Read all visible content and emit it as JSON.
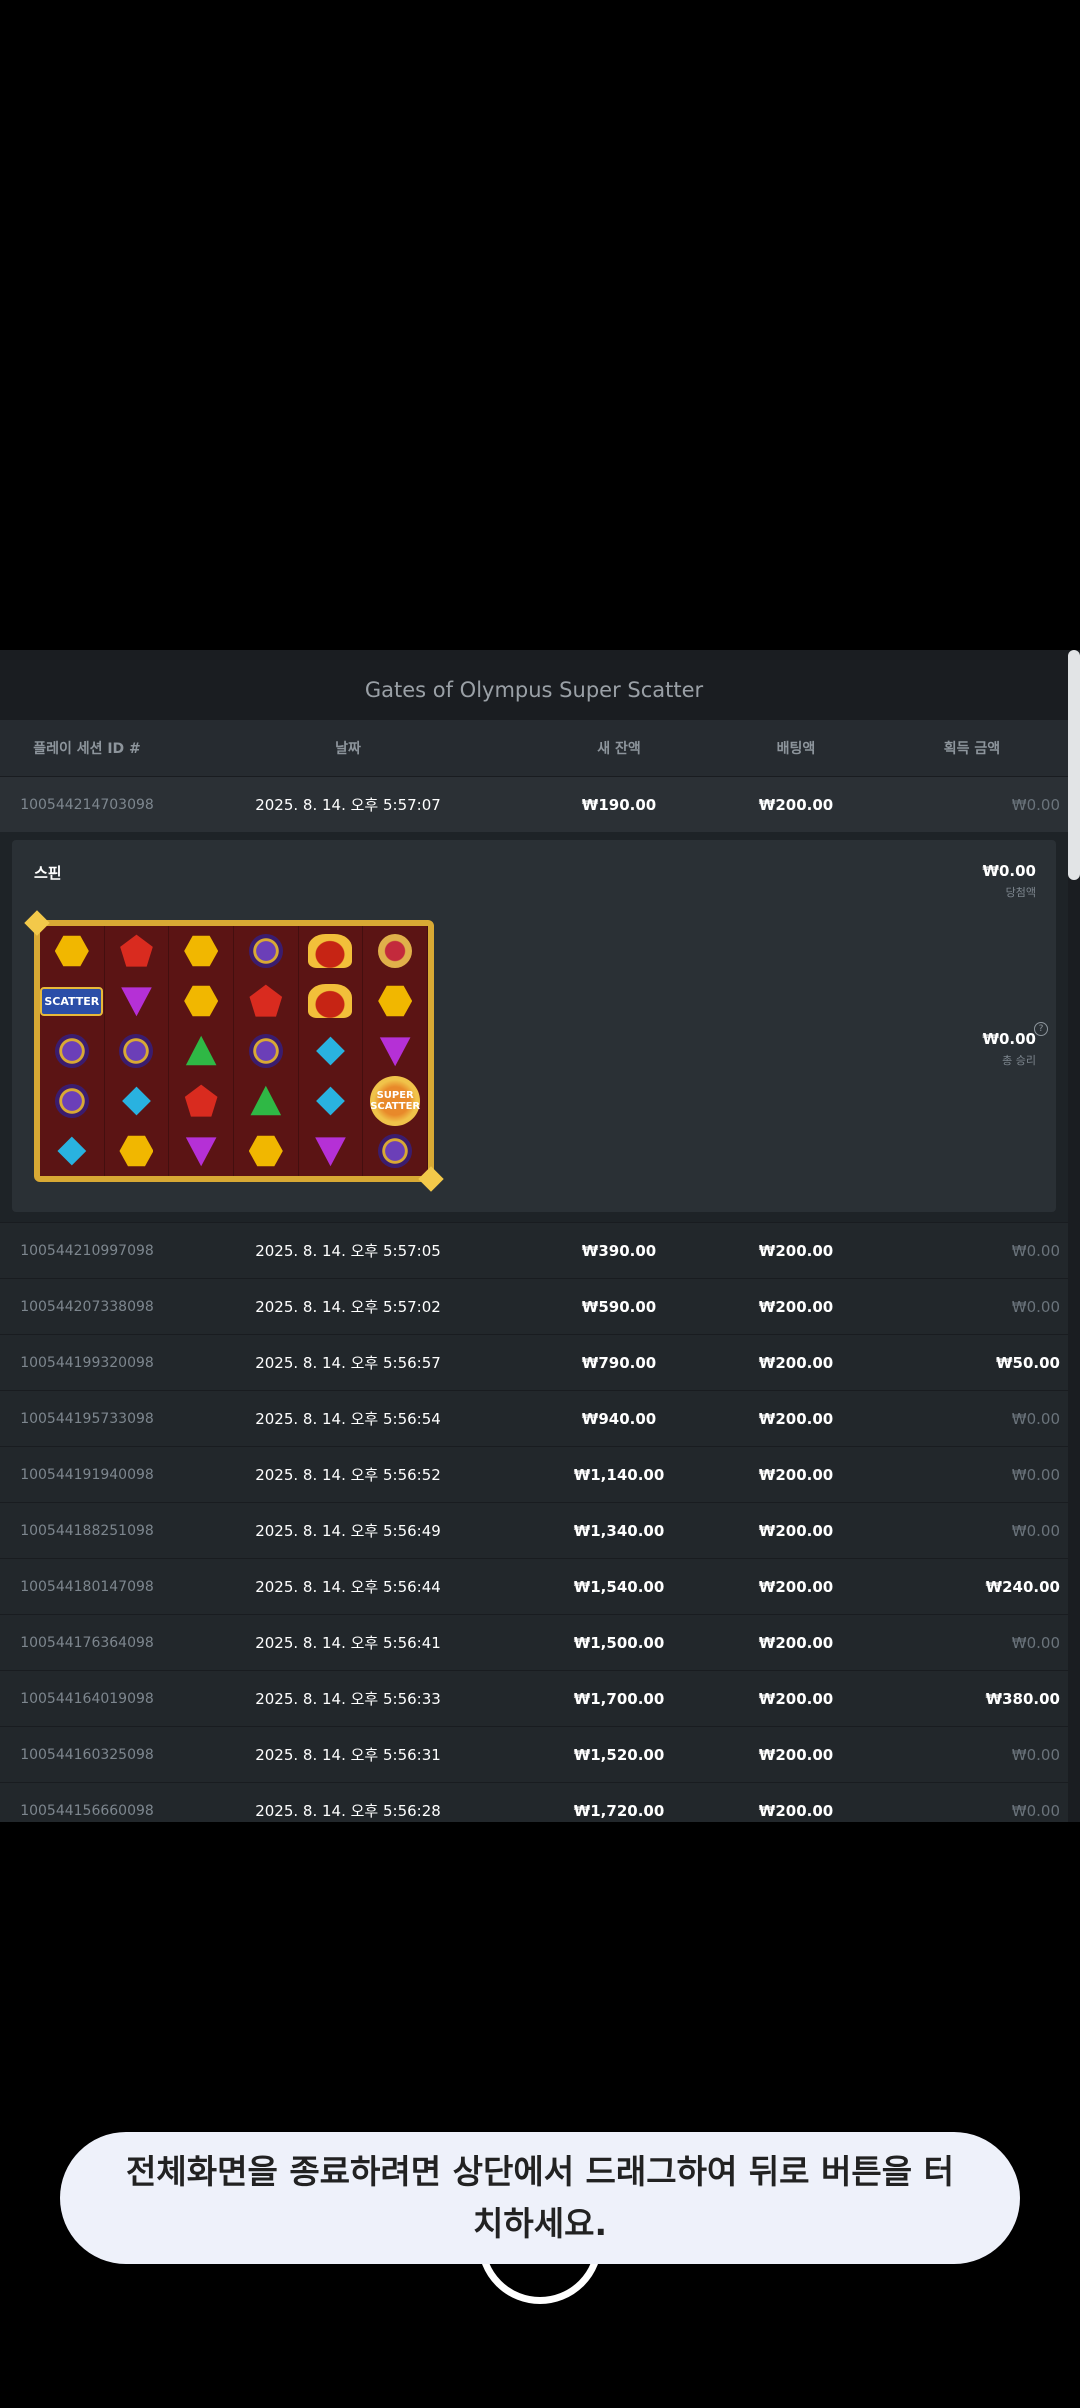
{
  "panel": {
    "title": "Gates of Olympus Super Scatter",
    "columns": {
      "session_id": "플레이 세션 ID #",
      "date": "날짜",
      "new_balance": "새 잔액",
      "bet": "배팅액",
      "win": "획득 금액"
    }
  },
  "selected_row": {
    "id": "100544214703098",
    "date": "2025. 8. 14. 오후 5:57:07",
    "balance": "₩190.00",
    "bet": "₩200.00",
    "win": "₩0.00"
  },
  "detail": {
    "spin_label": "스핀",
    "win_amount": "₩0.00",
    "win_label": "당첨액",
    "total_amount": "₩0.00",
    "total_label": "총 승리",
    "help_glyph": "?",
    "scatter_label": "SCATTER",
    "super_scatter_label": "SUPER SCATTER"
  },
  "rows": [
    {
      "id": "100544210997098",
      "date": "2025. 8. 14. 오후 5:57:05",
      "balance": "₩390.00",
      "bet": "₩200.00",
      "win": "₩0.00"
    },
    {
      "id": "100544207338098",
      "date": "2025. 8. 14. 오후 5:57:02",
      "balance": "₩590.00",
      "bet": "₩200.00",
      "win": "₩0.00"
    },
    {
      "id": "100544199320098",
      "date": "2025. 8. 14. 오후 5:56:57",
      "balance": "₩790.00",
      "bet": "₩200.00",
      "win": "₩50.00"
    },
    {
      "id": "100544195733098",
      "date": "2025. 8. 14. 오후 5:56:54",
      "balance": "₩940.00",
      "bet": "₩200.00",
      "win": "₩0.00"
    },
    {
      "id": "100544191940098",
      "date": "2025. 8. 14. 오후 5:56:52",
      "balance": "₩1,140.00",
      "bet": "₩200.00",
      "win": "₩0.00"
    },
    {
      "id": "100544188251098",
      "date": "2025. 8. 14. 오후 5:56:49",
      "balance": "₩1,340.00",
      "bet": "₩200.00",
      "win": "₩0.00"
    },
    {
      "id": "100544180147098",
      "date": "2025. 8. 14. 오후 5:56:44",
      "balance": "₩1,540.00",
      "bet": "₩200.00",
      "win": "₩240.00"
    },
    {
      "id": "100544176364098",
      "date": "2025. 8. 14. 오후 5:56:41",
      "balance": "₩1,500.00",
      "bet": "₩200.00",
      "win": "₩0.00"
    },
    {
      "id": "100544164019098",
      "date": "2025. 8. 14. 오후 5:56:33",
      "balance": "₩1,700.00",
      "bet": "₩200.00",
      "win": "₩380.00"
    },
    {
      "id": "100544160325098",
      "date": "2025. 8. 14. 오후 5:56:31",
      "balance": "₩1,520.00",
      "bet": "₩200.00",
      "win": "₩0.00"
    },
    {
      "id": "100544156660098",
      "date": "2025. 8. 14. 오후 5:56:28",
      "balance": "₩1,720.00",
      "bet": "₩200.00",
      "win": "₩0.00"
    }
  ],
  "board": {
    "columns": [
      [
        "hex",
        "scatter",
        "ring",
        "ring",
        "dia"
      ],
      [
        "pent",
        "tri-v",
        "ring",
        "dia",
        "hex"
      ],
      [
        "hex",
        "hex",
        "tri",
        "pent",
        "tri-v"
      ],
      [
        "ring",
        "pent",
        "ring",
        "tri",
        "hex"
      ],
      [
        "crown",
        "crown",
        "dia",
        "dia",
        "tri-v"
      ],
      [
        "cup",
        "hex",
        "tri-v",
        "super",
        "ring"
      ]
    ]
  },
  "toast": {
    "message": "전체화면을 종료하려면 상단에서 드래그하여 뒤로 버튼을 터치하세요."
  }
}
